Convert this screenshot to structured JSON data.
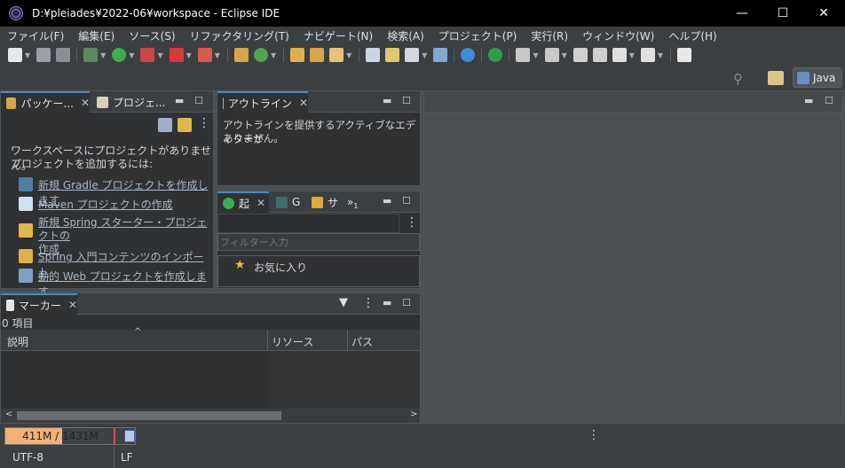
{
  "window": {
    "title": "D:¥pleiades¥2022-06¥workspace - Eclipse IDE",
    "minimize": "—",
    "maximize": "☐",
    "close": "✕"
  },
  "menu": [
    {
      "label": "ファイル(F)"
    },
    {
      "label": "編集(E)"
    },
    {
      "label": "ソース(S)"
    },
    {
      "label": "リファクタリング(T)"
    },
    {
      "label": "ナビゲート(N)"
    },
    {
      "label": "検索(A)"
    },
    {
      "label": "プロジェクト(P)"
    },
    {
      "label": "実行(R)"
    },
    {
      "label": "ウィンドウ(W)"
    },
    {
      "label": "ヘルプ(H)"
    }
  ],
  "perspective": {
    "label": "Java"
  },
  "package_explorer": {
    "tab1": "パッケー...",
    "tab2": "プロジェ...",
    "message_line1": "ワークスペースにプロジェクトがありません。",
    "message_line2": "プロジェクトを追加するには:",
    "links": [
      {
        "label": "新規 Gradle プロジェクトを作成します"
      },
      {
        "label": "Maven プロジェクトの作成"
      },
      {
        "label": "新規 Spring スターター・プロジェクトの"
      },
      {
        "label": "作成"
      },
      {
        "label": "Spring 入門コンテンツのインポート"
      },
      {
        "label": "動的 Web プロジェクトを作成します"
      }
    ]
  },
  "outline": {
    "tab": "アウトライン",
    "message_line1": "アウトラインを提供するアクティブなエディターが",
    "message_line2": "ありません。"
  },
  "start_view": {
    "tab1": "起",
    "tab2": "G",
    "tab3": "サ",
    "overflow": "»",
    "overflow_count": "1",
    "filter_placeholder": "フィルター入力",
    "favorites": "お気に入り"
  },
  "markers": {
    "tab": "マーカー",
    "count": "0 項目",
    "columns": [
      "説明",
      "リソース",
      "パス"
    ]
  },
  "status": {
    "heap": "411M / 1431M",
    "heap_fraction": 0.29,
    "encoding": "UTF-8",
    "line_delimiter": "LF"
  }
}
